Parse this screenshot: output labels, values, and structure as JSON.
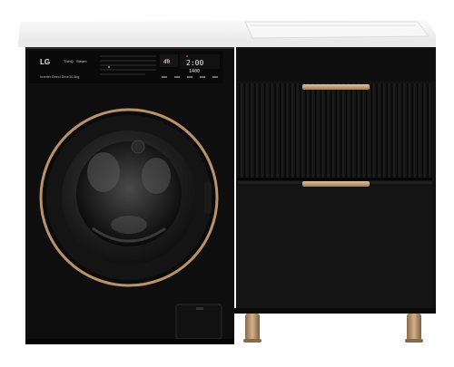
{
  "product": {
    "brand": "LG",
    "subbrand": "ThinQ",
    "wash_tech": "Steam",
    "drum_label": "Inverter Direct Drive",
    "capacity": "10.5kg",
    "display_time": "2:00",
    "display_temp": "40",
    "display_spin": "1400"
  },
  "colors": {
    "body": "#0d0d0d",
    "countertop": "#f2f2f2",
    "door_ring": "#b8926a",
    "handle": "#c9a77c",
    "legs": "#b08a62"
  }
}
